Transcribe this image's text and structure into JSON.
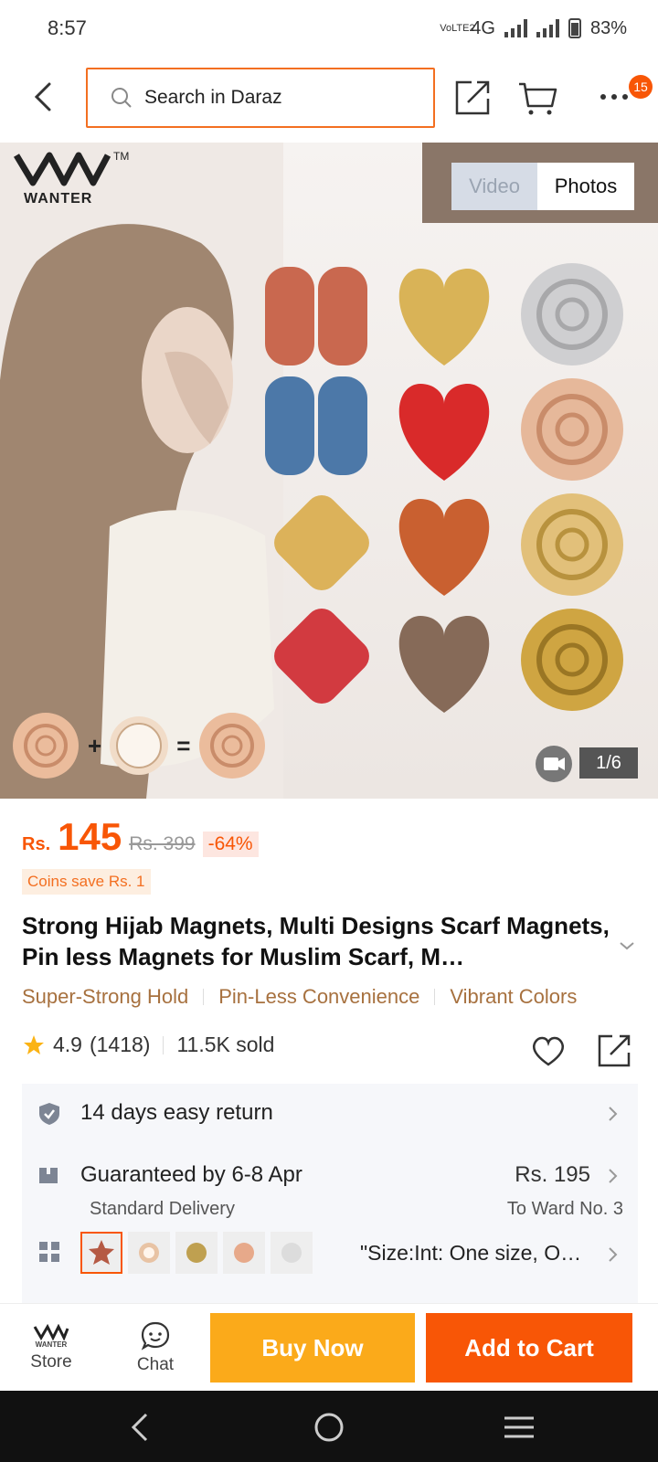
{
  "status_bar": {
    "time": "8:57",
    "network": "4G",
    "volte": "VoLTE2",
    "battery": "83%"
  },
  "top_nav": {
    "search_placeholder": "Search in Daraz",
    "cart_badge": "15"
  },
  "gallery": {
    "brand": "WANTER",
    "brand_mark": "TM",
    "tabs": [
      "Video",
      "Photos"
    ],
    "active_tab": "Photos",
    "counter": "1/6",
    "formula": {
      "plus": "+",
      "equals": "="
    }
  },
  "product": {
    "currency": "Rs.",
    "price": "145",
    "original_price": "Rs. 399",
    "discount": "-64%",
    "coins": "Coins save Rs. 1",
    "title": "Strong Hijab Magnets, Multi Designs Scarf Magnets, Pin less Magnets for Muslim Scarf, M…",
    "tags": [
      "Super-Strong Hold",
      "Pin-Less Convenience",
      "Vibrant Colors"
    ],
    "rating": "4.9",
    "reviews": "(1418)",
    "sold": "11.5K sold"
  },
  "info": {
    "return": "14 days easy return",
    "delivery_title": "Guaranteed by 6-8 Apr",
    "delivery_price": "Rs. 195",
    "delivery_type": "Standard Delivery",
    "delivery_to": "To Ward No. 3",
    "variant_text": "\"Size:Int: One size, O…"
  },
  "bottom_bar": {
    "store_label": "Store",
    "store_logo": "WANTER",
    "chat_label": "Chat",
    "buy_now": "Buy Now",
    "add_to_cart": "Add to Cart"
  },
  "colors": {
    "accent": "#f85606",
    "buy_now": "#fbaa1a",
    "search_border": "#f36f21",
    "tag_text": "#a7713f"
  }
}
